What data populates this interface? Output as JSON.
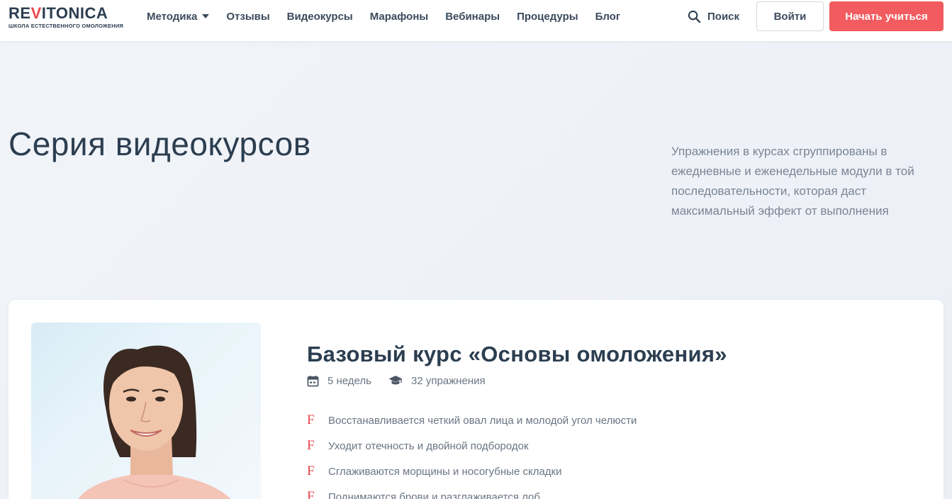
{
  "logo": {
    "name_before": "RE",
    "name_accent": "V",
    "name_after": "ITONICA",
    "tagline": "ШКОЛА ЕСТЕСТВЕННОГО ОМОЛОЖЕНИЯ"
  },
  "nav": {
    "items": [
      {
        "label": "Методика",
        "has_dropdown": true
      },
      {
        "label": "Отзывы"
      },
      {
        "label": "Видеокурсы"
      },
      {
        "label": "Марафоны"
      },
      {
        "label": "Вебинары"
      },
      {
        "label": "Процедуры"
      },
      {
        "label": "Блог"
      }
    ]
  },
  "header": {
    "search_label": "Поиск",
    "search_icon": "search-icon",
    "login_label": "Войти",
    "start_label": "Начать учиться"
  },
  "hero": {
    "title": "Серия видеокурсов",
    "description": "Упражнения в курсах сгруппированы в ежедневные и еженедельные модули в той последовательности, которая даст максимальный эффект от выполнения"
  },
  "course": {
    "title": "Базовый курс «Основы омоложения»",
    "duration": "5 недель",
    "duration_icon": "calendar-icon",
    "exercises": "32 упражнения",
    "exercises_icon": "graduation-cap-icon",
    "benefits": [
      "Восстанавливается четкий овал лица и молодой угол челюсти",
      "Уходит отечность и двойной подбородок",
      "Сглаживаются морщины и носогубные складки",
      "Поднимаются брови и разглаживается лоб"
    ]
  },
  "colors": {
    "accent": "#f25b5f",
    "brand_red": "#e8474c",
    "text_dark": "#2c3e50",
    "text_muted": "#6b7583"
  }
}
